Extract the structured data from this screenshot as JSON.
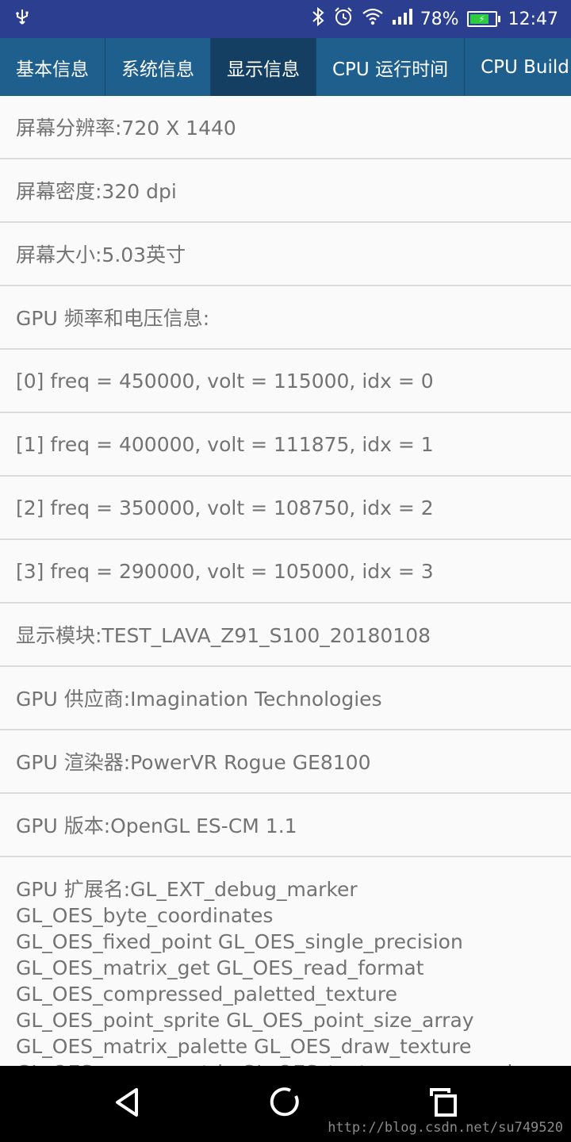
{
  "status_bar": {
    "battery_percent": "78%",
    "battery_level": 0.78,
    "time": "12:47",
    "icons": [
      "usb-icon",
      "bluetooth-icon",
      "alarm-icon",
      "wifi-icon",
      "signal-icon",
      "battery-icon"
    ]
  },
  "tabs": [
    {
      "label": "基本信息",
      "active": false
    },
    {
      "label": "系统信息",
      "active": false
    },
    {
      "label": "显示信息",
      "active": true
    },
    {
      "label": "CPU 运行时间",
      "active": false
    },
    {
      "label": "CPU Build",
      "active": false
    }
  ],
  "rows": [
    "屏幕分辨率:720 X 1440",
    "屏幕密度:320 dpi",
    "屏幕大小:5.03英寸",
    "GPU 频率和电压信息:",
    "[0] freq = 450000, volt = 115000, idx = 0",
    "[1] freq = 400000, volt = 111875, idx = 1",
    "[2] freq = 350000, volt = 108750, idx = 2",
    "[3] freq = 290000, volt = 105000, idx = 3",
    "显示模块:TEST_LAVA_Z91_S100_20180108",
    "GPU 供应商:Imagination Technologies",
    "GPU 渲染器:PowerVR Rogue GE8100",
    "GPU 版本:OpenGL ES-CM 1.1"
  ],
  "extensions": {
    "lines": [
      "GPU 扩展名:GL_EXT_debug_marker",
      "GL_OES_byte_coordinates",
      "GL_OES_fixed_point GL_OES_single_precision",
      "GL_OES_matrix_get GL_OES_read_format",
      "GL_OES_compressed_paletted_texture",
      "GL_OES_point_sprite GL_OES_point_size_array",
      "GL_OES_matrix_palette GL_OES_draw_texture",
      "GL_OES_query_matrix GL_OES_texture_env_crossbar"
    ]
  },
  "nav_bar": {
    "buttons": [
      "back-icon",
      "home-icon",
      "recents-icon"
    ]
  },
  "watermark": "http://blog.csdn.net/su749520",
  "colors": {
    "status_bar": "#2c3e8f",
    "tab_bar": "#1f5f8e",
    "tab_active": "#143f63",
    "text": "#737373",
    "battery_fill": "#2ecc40"
  }
}
